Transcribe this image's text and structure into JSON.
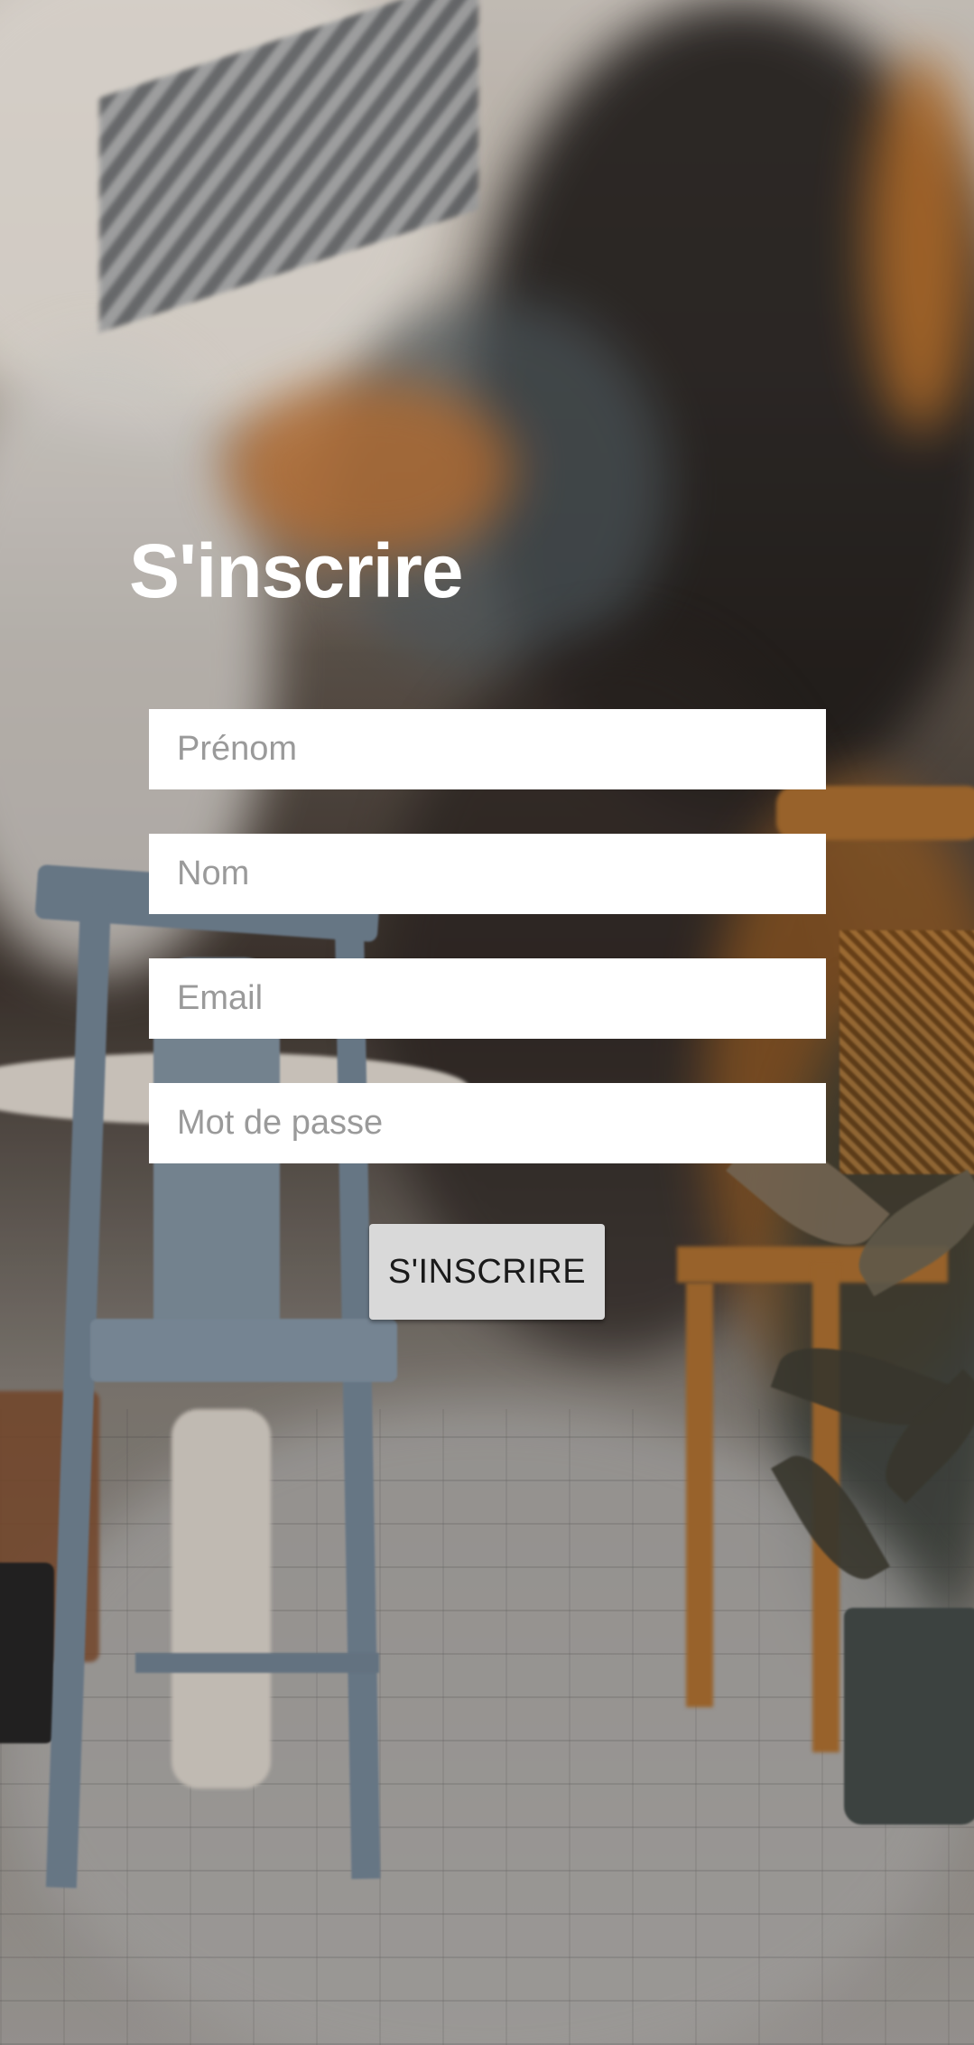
{
  "signup": {
    "title": "S'inscrire",
    "fields": {
      "first_name": {
        "placeholder": "Prénom",
        "value": ""
      },
      "last_name": {
        "placeholder": "Nom",
        "value": ""
      },
      "email": {
        "placeholder": "Email",
        "value": ""
      },
      "password": {
        "placeholder": "Mot de passe",
        "value": ""
      }
    },
    "submit_label": "S'INSCRIRE"
  },
  "colors": {
    "title_text": "#ffffff",
    "field_background": "#ffffff",
    "placeholder_text": "#9a9a9a",
    "button_background": "#d9d9d9",
    "button_text": "#1a1a1a"
  },
  "background": {
    "icon": "cafe-street-photo"
  }
}
